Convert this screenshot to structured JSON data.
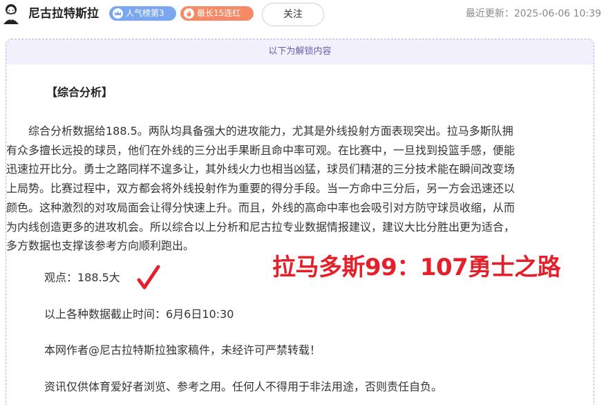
{
  "header": {
    "author": "尼古拉特斯拉",
    "badge_popularity": "人气榜第3",
    "badge_streak": "最长15连红",
    "follow_label": "关注",
    "update_time": "最近更新：2025-06-06 10:39"
  },
  "content": {
    "unlock_notice": "以下为解锁内容",
    "heading": "【综合分析】",
    "paragraph_lines": [
      "综合分析数据给188.5。两队均具备强大的进攻能力，尤其是外线投射方面表现突出。拉马多斯队拥",
      "有众多擅长远投的球员，他们在外线的三分出手果断且命中率可观。在比赛中，一旦找到投篮手感，便能",
      "迅速拉开比分。勇士之路同样不遑多让，其外线火力也相当凶猛，球员们精湛的三分技术能在瞬间改变场",
      "上局势。比赛过程中，双方都会将外线投射作为重要的得分手段。当一方命中三分后，另一方会迅速还以",
      "颜色。这种激烈的对攻局面会让得分快速上升。而且，外线的高命中率也会吸引对方防守球员收缩，从而",
      "为内线创造更多的进攻机会。所以综合以上分析和尼古拉专业数据情报建议，建议大比分胜出更为适合，",
      "多方数据也支撑该参考方向顺利跑出。"
    ],
    "opinion": "观点：188.5大",
    "score_prediction": "拉马多斯99：107勇士之路",
    "data_cutoff": "以上各种数据截止时间：6月6日10:30",
    "author_note": "本网作者@尼古拉特斯拉独家稿件，未经许可严禁转载！",
    "disclaimer": "资讯仅供体育爱好者浏览、参考之用。任何人不得用于非法用途，否则责任自负。"
  },
  "colors": {
    "badge_popularity": "#7aa7f0",
    "badge_streak": "#f58a67",
    "score_red": "#e5202a",
    "unlock_bg": "#f2f0fb"
  },
  "icons": {
    "avatar": "avatar-portrait",
    "badge_popularity": "crown-icon",
    "badge_streak": "flame-icon",
    "check": "checkmark-icon"
  }
}
